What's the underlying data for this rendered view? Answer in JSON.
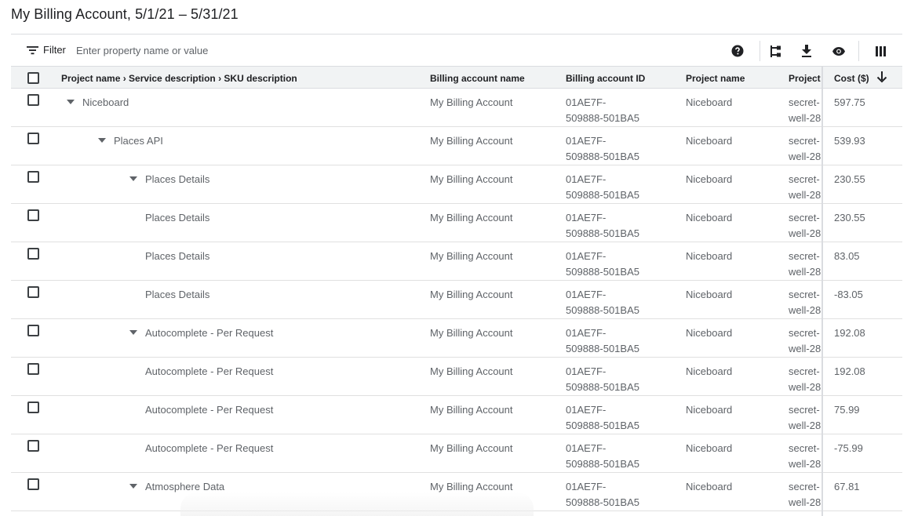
{
  "page": {
    "title": "My Billing Account, 5/1/21 – 5/31/21"
  },
  "toolbar": {
    "filter_label": "Filter",
    "filter_placeholder": "Enter property name or value",
    "icons": [
      "help-icon",
      "group-by-icon",
      "download-icon",
      "visibility-icon",
      "columns-icon"
    ]
  },
  "table": {
    "columns": {
      "name": "Project name › Service description › SKU description",
      "account": "Billing account name",
      "account_id": "Billing account ID",
      "project": "Project name",
      "project_id": "Project",
      "cost": "Cost ($)"
    },
    "sort": {
      "column": "cost",
      "direction": "descending"
    },
    "rows": [
      {
        "level": 0,
        "expandable": true,
        "name": "Niceboard",
        "account": "My Billing Account",
        "account_id": "01AE7F-509888-501BA5",
        "project": "Niceboard",
        "project_id": "secret-well-28",
        "cost": "597.75"
      },
      {
        "level": 1,
        "expandable": true,
        "name": "Places API",
        "account": "My Billing Account",
        "account_id": "01AE7F-509888-501BA5",
        "project": "Niceboard",
        "project_id": "secret-well-28",
        "cost": "539.93"
      },
      {
        "level": 2,
        "expandable": true,
        "name": "Places Details",
        "account": "My Billing Account",
        "account_id": "01AE7F-509888-501BA5",
        "project": "Niceboard",
        "project_id": "secret-well-28",
        "cost": "230.55"
      },
      {
        "level": 3,
        "expandable": false,
        "name": "Places Details",
        "account": "My Billing Account",
        "account_id": "01AE7F-509888-501BA5",
        "project": "Niceboard",
        "project_id": "secret-well-28",
        "cost": "230.55"
      },
      {
        "level": 3,
        "expandable": false,
        "name": "Places Details",
        "account": "My Billing Account",
        "account_id": "01AE7F-509888-501BA5",
        "project": "Niceboard",
        "project_id": "secret-well-28",
        "cost": "83.05"
      },
      {
        "level": 3,
        "expandable": false,
        "name": "Places Details",
        "account": "My Billing Account",
        "account_id": "01AE7F-509888-501BA5",
        "project": "Niceboard",
        "project_id": "secret-well-28",
        "cost": "-83.05"
      },
      {
        "level": 2,
        "expandable": true,
        "name": "Autocomplete - Per Request",
        "account": "My Billing Account",
        "account_id": "01AE7F-509888-501BA5",
        "project": "Niceboard",
        "project_id": "secret-well-28",
        "cost": "192.08"
      },
      {
        "level": 3,
        "expandable": false,
        "name": "Autocomplete - Per Request",
        "account": "My Billing Account",
        "account_id": "01AE7F-509888-501BA5",
        "project": "Niceboard",
        "project_id": "secret-well-28",
        "cost": "192.08"
      },
      {
        "level": 3,
        "expandable": false,
        "name": "Autocomplete - Per Request",
        "account": "My Billing Account",
        "account_id": "01AE7F-509888-501BA5",
        "project": "Niceboard",
        "project_id": "secret-well-28",
        "cost": "75.99"
      },
      {
        "level": 3,
        "expandable": false,
        "name": "Autocomplete - Per Request",
        "account": "My Billing Account",
        "account_id": "01AE7F-509888-501BA5",
        "project": "Niceboard",
        "project_id": "secret-well-28",
        "cost": "-75.99"
      },
      {
        "level": 2,
        "expandable": true,
        "name": "Atmosphere Data",
        "account": "My Billing Account",
        "account_id": "01AE7F-509888-501BA5",
        "project": "Niceboard",
        "project_id": "secret-well-28",
        "cost": "67.81"
      }
    ]
  }
}
